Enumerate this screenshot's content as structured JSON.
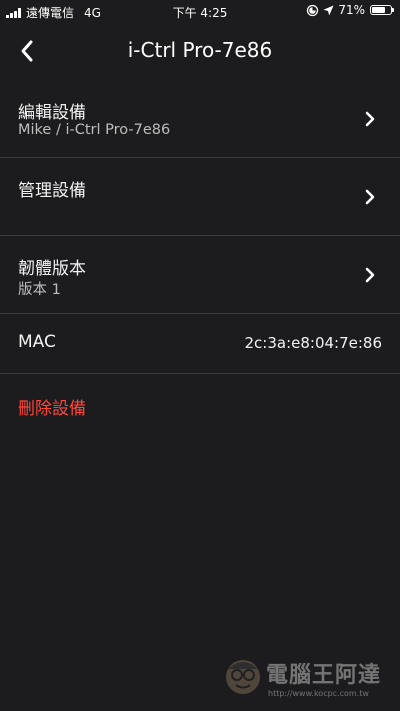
{
  "status_bar": {
    "carrier": "遠傳電信",
    "network": "4G",
    "time": "下午 4:25",
    "battery_percent": "71%",
    "battery_level": 0.71
  },
  "nav": {
    "title": "i-Ctrl Pro-7e86"
  },
  "rows": {
    "edit_device": {
      "title": "編輯設備",
      "subtitle": "Mike / i-Ctrl Pro-7e86"
    },
    "manage_device": {
      "title": "管理設備"
    },
    "firmware": {
      "title": "韌體版本",
      "subtitle": "版本 1"
    },
    "mac": {
      "label": "MAC",
      "value": "2c:3a:e8:04:7e:86"
    }
  },
  "delete_label": "刪除設備",
  "watermark": {
    "title": "電腦王阿達",
    "url": "http://www.kocpc.com.tw"
  },
  "colors": {
    "background": "#1c1c1e",
    "separator": "#3a3a3c",
    "destructive": "#ff453a",
    "text": "#f2f2f2"
  },
  "icons": [
    "signal-icon",
    "location-icon",
    "location-arrow-icon",
    "battery-icon",
    "back-chevron-icon",
    "chevron-right-icon"
  ]
}
